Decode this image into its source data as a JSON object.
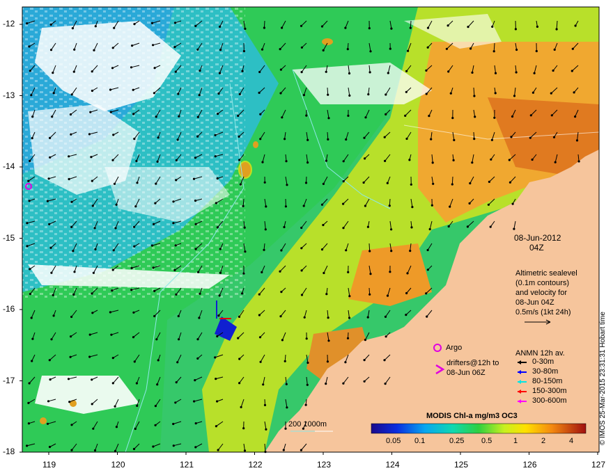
{
  "map": {
    "date": "08-Jun-2012",
    "time": "04Z",
    "x_ticks": [
      "119",
      "120",
      "121",
      "122",
      "123",
      "124",
      "125",
      "126",
      "127"
    ],
    "y_ticks": [
      "-12",
      "-13",
      "-14",
      "-15",
      "-16",
      "-17",
      "-18"
    ],
    "altimetry_note": [
      "Altimetric sealevel",
      "(0.1m contours)",
      "and velocity for",
      "08-Jun 04Z",
      "0.5m/s (1kt 24h)"
    ],
    "argo_label": "Argo",
    "drifters_label": [
      "drifters@12h to",
      "08-Jun 06Z"
    ],
    "anmn_title": "ANMN 12h av.",
    "anmn_depths": [
      {
        "label": "0-30m",
        "color": "#000000"
      },
      {
        "label": "30-80m",
        "color": "#0000ff"
      },
      {
        "label": "80-150m",
        "color": "#00e5e5"
      },
      {
        "label": "150-300m",
        "color": "#ff0000"
      },
      {
        "label": "300-600m",
        "color": "#ff00ff"
      }
    ],
    "colorbar_title": "MODIS Chl-a mg/m3 OC3",
    "colorbar_ticks": [
      "0.05",
      "0.1",
      "0.25",
      "0.5",
      "1",
      "2",
      "4"
    ],
    "scale_label": "200  1000m",
    "credit": "© IMOS 25-Mar-2015 23:31:31 Hobart time",
    "colors": {
      "land": "#f6c59c",
      "ocean_low": "#2fb9c9",
      "ocean_mid": "#3cc84a",
      "ocean_high": "#f0a020",
      "cloud": "#ffffff",
      "vector": "#000000",
      "argo": "#e000e0",
      "drifter": "#0000ff"
    }
  }
}
